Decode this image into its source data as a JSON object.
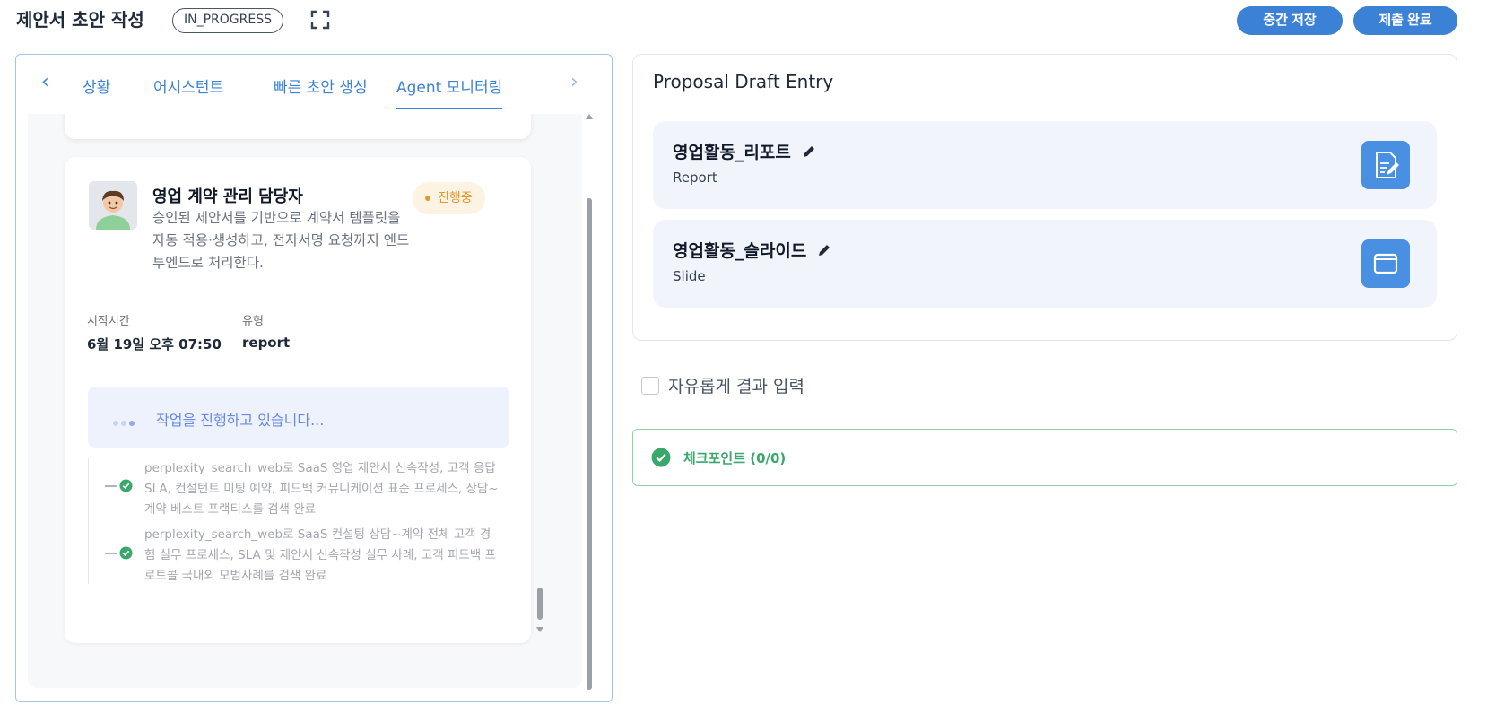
{
  "header": {
    "title": "제안서 초안 작성",
    "status": "IN_PROGRESS",
    "save_label": "중간 저장",
    "submit_label": "제출 완료"
  },
  "tabs": [
    {
      "label": "상황",
      "active": false
    },
    {
      "label": "어시스턴트",
      "active": false
    },
    {
      "label": "빠른 초안 생성",
      "active": false
    },
    {
      "label": "Agent 모니터링",
      "active": true
    }
  ],
  "agent": {
    "name": "영업 계약 관리 담당자",
    "description": "승인된 제안서를 기반으로 계약서 템플릿을 자동 적용·생성하고, 전자서명 요청까지 엔드투엔드로 처리한다.",
    "status": "진행중",
    "start_label": "시작시간",
    "start_value": "6월 19일 오후 07:50",
    "type_label": "유형",
    "type_value": "report",
    "progress_text": "작업을 진행하고 있습니다...",
    "logs": [
      "perplexity_search_web로 SaaS 영업 제안서 신속작성, 고객 응답 SLA, 컨설턴트 미팅 예약, 피드백 커뮤니케이션 표준 프로세스, 상담~계약 베스트 프랙티스를 검색 완료",
      "perplexity_search_web로 SaaS 컨설팅 상담~계약 전체 고객 경험 실무 프로세스, SLA 및 제안서 신속작성 실무 사례, 고객 피드백 프로토콜 국내외 모범사례를 검색 완료"
    ]
  },
  "proposal": {
    "title": "Proposal Draft Entry",
    "entries": [
      {
        "name": "영업활동_리포트",
        "type": "Report",
        "icon": "document-edit-icon"
      },
      {
        "name": "영업활동_슬라이드",
        "type": "Slide",
        "icon": "slide-icon"
      }
    ]
  },
  "free_input": {
    "label": "자유롭게 결과 입력",
    "checked": false
  },
  "checkpoint": {
    "label": "체크포인트 (0/0)"
  },
  "colors": {
    "accent": "#3b82d6",
    "warning": "#e0982f",
    "success": "#3aa86b"
  }
}
